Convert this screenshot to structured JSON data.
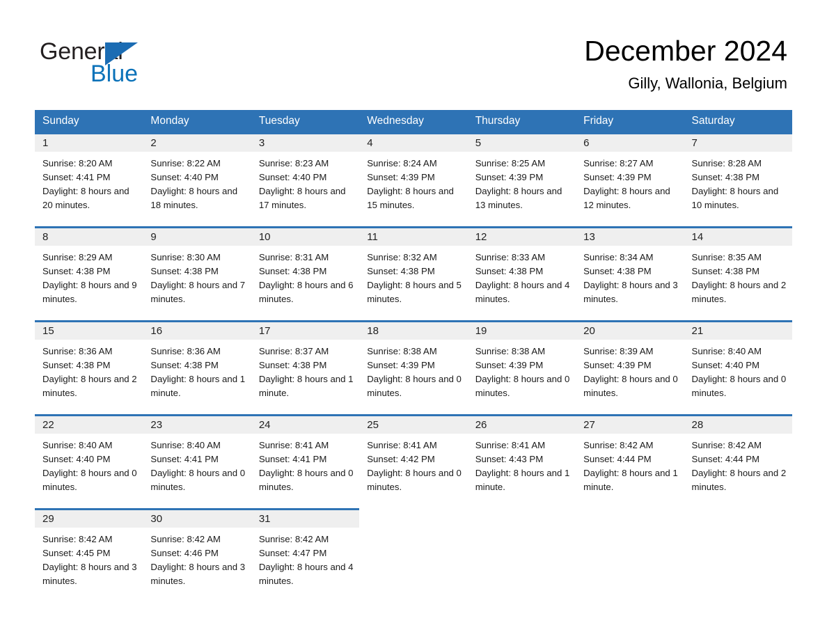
{
  "brand": {
    "name_part1": "General",
    "name_part2": "Blue",
    "accent_color": "#1b6cb3",
    "triangle_icon": "brand-triangle-icon"
  },
  "header": {
    "title": "December 2024",
    "location": "Gilly, Wallonia, Belgium"
  },
  "calendar": {
    "header_bg": "#2e73b5",
    "date_band_bg": "#efefef",
    "daynames": [
      "Sunday",
      "Monday",
      "Tuesday",
      "Wednesday",
      "Thursday",
      "Friday",
      "Saturday"
    ],
    "weeks": [
      [
        {
          "date": "1",
          "sunrise": "Sunrise: 8:20 AM",
          "sunset": "Sunset: 4:41 PM",
          "daylight": "Daylight: 8 hours and 20 minutes."
        },
        {
          "date": "2",
          "sunrise": "Sunrise: 8:22 AM",
          "sunset": "Sunset: 4:40 PM",
          "daylight": "Daylight: 8 hours and 18 minutes."
        },
        {
          "date": "3",
          "sunrise": "Sunrise: 8:23 AM",
          "sunset": "Sunset: 4:40 PM",
          "daylight": "Daylight: 8 hours and 17 minutes."
        },
        {
          "date": "4",
          "sunrise": "Sunrise: 8:24 AM",
          "sunset": "Sunset: 4:39 PM",
          "daylight": "Daylight: 8 hours and 15 minutes."
        },
        {
          "date": "5",
          "sunrise": "Sunrise: 8:25 AM",
          "sunset": "Sunset: 4:39 PM",
          "daylight": "Daylight: 8 hours and 13 minutes."
        },
        {
          "date": "6",
          "sunrise": "Sunrise: 8:27 AM",
          "sunset": "Sunset: 4:39 PM",
          "daylight": "Daylight: 8 hours and 12 minutes."
        },
        {
          "date": "7",
          "sunrise": "Sunrise: 8:28 AM",
          "sunset": "Sunset: 4:38 PM",
          "daylight": "Daylight: 8 hours and 10 minutes."
        }
      ],
      [
        {
          "date": "8",
          "sunrise": "Sunrise: 8:29 AM",
          "sunset": "Sunset: 4:38 PM",
          "daylight": "Daylight: 8 hours and 9 minutes."
        },
        {
          "date": "9",
          "sunrise": "Sunrise: 8:30 AM",
          "sunset": "Sunset: 4:38 PM",
          "daylight": "Daylight: 8 hours and 7 minutes."
        },
        {
          "date": "10",
          "sunrise": "Sunrise: 8:31 AM",
          "sunset": "Sunset: 4:38 PM",
          "daylight": "Daylight: 8 hours and 6 minutes."
        },
        {
          "date": "11",
          "sunrise": "Sunrise: 8:32 AM",
          "sunset": "Sunset: 4:38 PM",
          "daylight": "Daylight: 8 hours and 5 minutes."
        },
        {
          "date": "12",
          "sunrise": "Sunrise: 8:33 AM",
          "sunset": "Sunset: 4:38 PM",
          "daylight": "Daylight: 8 hours and 4 minutes."
        },
        {
          "date": "13",
          "sunrise": "Sunrise: 8:34 AM",
          "sunset": "Sunset: 4:38 PM",
          "daylight": "Daylight: 8 hours and 3 minutes."
        },
        {
          "date": "14",
          "sunrise": "Sunrise: 8:35 AM",
          "sunset": "Sunset: 4:38 PM",
          "daylight": "Daylight: 8 hours and 2 minutes."
        }
      ],
      [
        {
          "date": "15",
          "sunrise": "Sunrise: 8:36 AM",
          "sunset": "Sunset: 4:38 PM",
          "daylight": "Daylight: 8 hours and 2 minutes."
        },
        {
          "date": "16",
          "sunrise": "Sunrise: 8:36 AM",
          "sunset": "Sunset: 4:38 PM",
          "daylight": "Daylight: 8 hours and 1 minute."
        },
        {
          "date": "17",
          "sunrise": "Sunrise: 8:37 AM",
          "sunset": "Sunset: 4:38 PM",
          "daylight": "Daylight: 8 hours and 1 minute."
        },
        {
          "date": "18",
          "sunrise": "Sunrise: 8:38 AM",
          "sunset": "Sunset: 4:39 PM",
          "daylight": "Daylight: 8 hours and 0 minutes."
        },
        {
          "date": "19",
          "sunrise": "Sunrise: 8:38 AM",
          "sunset": "Sunset: 4:39 PM",
          "daylight": "Daylight: 8 hours and 0 minutes."
        },
        {
          "date": "20",
          "sunrise": "Sunrise: 8:39 AM",
          "sunset": "Sunset: 4:39 PM",
          "daylight": "Daylight: 8 hours and 0 minutes."
        },
        {
          "date": "21",
          "sunrise": "Sunrise: 8:40 AM",
          "sunset": "Sunset: 4:40 PM",
          "daylight": "Daylight: 8 hours and 0 minutes."
        }
      ],
      [
        {
          "date": "22",
          "sunrise": "Sunrise: 8:40 AM",
          "sunset": "Sunset: 4:40 PM",
          "daylight": "Daylight: 8 hours and 0 minutes."
        },
        {
          "date": "23",
          "sunrise": "Sunrise: 8:40 AM",
          "sunset": "Sunset: 4:41 PM",
          "daylight": "Daylight: 8 hours and 0 minutes."
        },
        {
          "date": "24",
          "sunrise": "Sunrise: 8:41 AM",
          "sunset": "Sunset: 4:41 PM",
          "daylight": "Daylight: 8 hours and 0 minutes."
        },
        {
          "date": "25",
          "sunrise": "Sunrise: 8:41 AM",
          "sunset": "Sunset: 4:42 PM",
          "daylight": "Daylight: 8 hours and 0 minutes."
        },
        {
          "date": "26",
          "sunrise": "Sunrise: 8:41 AM",
          "sunset": "Sunset: 4:43 PM",
          "daylight": "Daylight: 8 hours and 1 minute."
        },
        {
          "date": "27",
          "sunrise": "Sunrise: 8:42 AM",
          "sunset": "Sunset: 4:44 PM",
          "daylight": "Daylight: 8 hours and 1 minute."
        },
        {
          "date": "28",
          "sunrise": "Sunrise: 8:42 AM",
          "sunset": "Sunset: 4:44 PM",
          "daylight": "Daylight: 8 hours and 2 minutes."
        }
      ],
      [
        {
          "date": "29",
          "sunrise": "Sunrise: 8:42 AM",
          "sunset": "Sunset: 4:45 PM",
          "daylight": "Daylight: 8 hours and 3 minutes."
        },
        {
          "date": "30",
          "sunrise": "Sunrise: 8:42 AM",
          "sunset": "Sunset: 4:46 PM",
          "daylight": "Daylight: 8 hours and 3 minutes."
        },
        {
          "date": "31",
          "sunrise": "Sunrise: 8:42 AM",
          "sunset": "Sunset: 4:47 PM",
          "daylight": "Daylight: 8 hours and 4 minutes."
        },
        {
          "date": "",
          "sunrise": "",
          "sunset": "",
          "daylight": ""
        },
        {
          "date": "",
          "sunrise": "",
          "sunset": "",
          "daylight": ""
        },
        {
          "date": "",
          "sunrise": "",
          "sunset": "",
          "daylight": ""
        },
        {
          "date": "",
          "sunrise": "",
          "sunset": "",
          "daylight": ""
        }
      ]
    ]
  }
}
